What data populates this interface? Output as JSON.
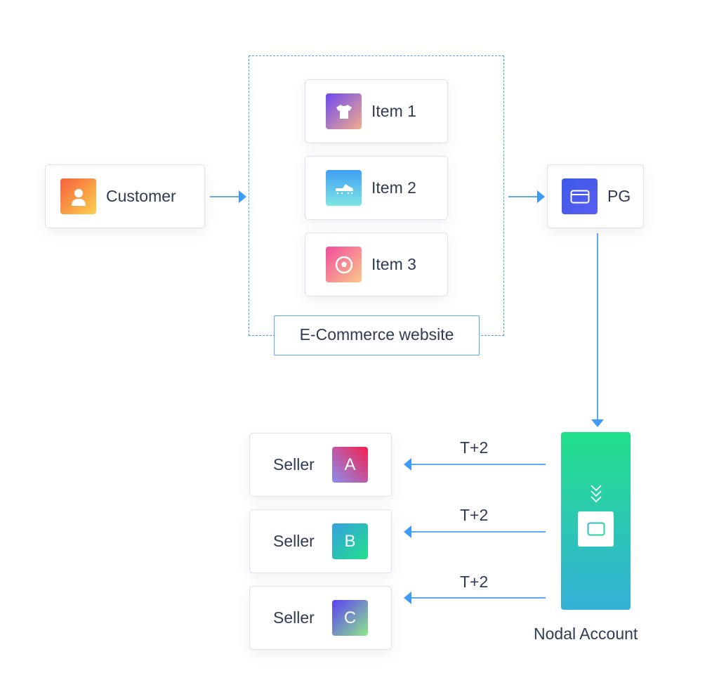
{
  "customer": {
    "label": "Customer",
    "icon": "person-icon"
  },
  "website": {
    "label": "E-Commerce website",
    "items": [
      {
        "label": "Item 1",
        "icon": "tshirt-icon"
      },
      {
        "label": "Item 2",
        "icon": "shoe-icon"
      },
      {
        "label": "Item 3",
        "icon": "football-icon"
      }
    ]
  },
  "pg": {
    "label": "PG",
    "icon": "card-icon"
  },
  "nodal": {
    "label": "Nodal Account",
    "icon": "card-icon"
  },
  "sellers": [
    {
      "label": "Seller",
      "badge": "A",
      "transfer": "T+2"
    },
    {
      "label": "Seller",
      "badge": "B",
      "transfer": "T+2"
    },
    {
      "label": "Seller",
      "badge": "C",
      "transfer": "T+2"
    }
  ],
  "colors": {
    "arrow": "#3f9cf5",
    "text": "#2f3b55",
    "nodal_top": "#22e08a",
    "nodal_bottom": "#35b0d8"
  }
}
